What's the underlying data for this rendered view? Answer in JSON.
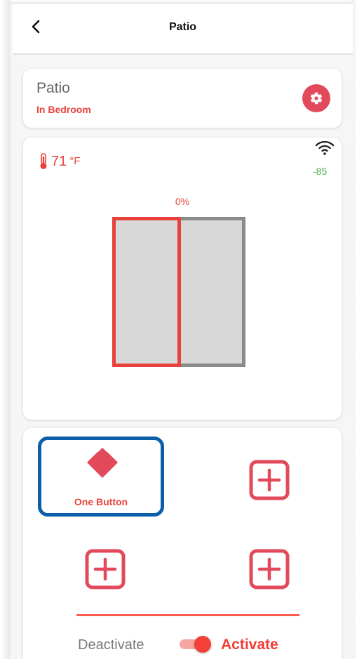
{
  "header": {
    "title": "Patio",
    "back_icon": "chevron-left"
  },
  "device": {
    "name": "Patio",
    "room": "In Bedroom",
    "settings_icon": "gear"
  },
  "status": {
    "temperature_value": "71",
    "temperature_unit": "°F",
    "thermometer_icon": "thermometer",
    "wifi_icon": "wifi",
    "signal_strength": "-85",
    "shade_position": "0%"
  },
  "buttons": {
    "one_button_label": "One Button",
    "one_button_icon": "diamond",
    "add_icon": "plus-square"
  },
  "mode": {
    "deactivate_label": "Deactivate",
    "activate_label": "Activate",
    "toggle_on": true
  },
  "colors": {
    "accent": "#e8413c",
    "settings_bg": "#e24a5c",
    "selection_border": "#0b5ea8",
    "signal_green": "#4caf50"
  }
}
